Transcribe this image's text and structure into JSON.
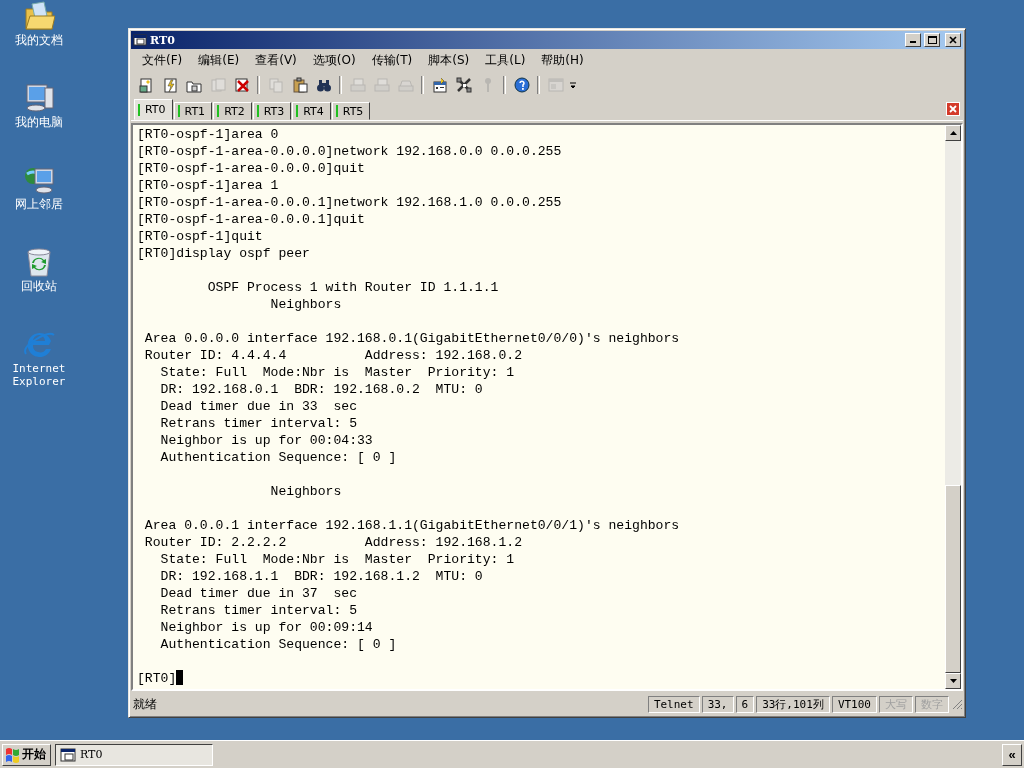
{
  "desktop_icons": [
    {
      "kind": "documents",
      "label": "我的文档"
    },
    {
      "kind": "computer",
      "label": "我的电脑"
    },
    {
      "kind": "network",
      "label": "网上邻居"
    },
    {
      "kind": "recycle",
      "label": "回收站"
    },
    {
      "kind": "browser",
      "label": "Internet Explorer"
    }
  ],
  "window": {
    "title": "RT0"
  },
  "menu": [
    "文件(F)",
    "编辑(E)",
    "查看(V)",
    "选项(O)",
    "传输(T)",
    "脚本(S)",
    "工具(L)",
    "帮助(H)"
  ],
  "toolbar": [
    {
      "kind": "new",
      "disabled": false
    },
    {
      "kind": "quick",
      "disabled": false
    },
    {
      "kind": "folder",
      "disabled": false
    },
    {
      "kind": "reconnect",
      "disabled": true
    },
    {
      "kind": "disconnect",
      "disabled": false
    },
    {
      "kind": "separator"
    },
    {
      "kind": "copy",
      "disabled": true
    },
    {
      "kind": "paste",
      "disabled": false
    },
    {
      "kind": "find",
      "disabled": false
    },
    {
      "kind": "separator"
    },
    {
      "kind": "print",
      "disabled": true
    },
    {
      "kind": "print",
      "disabled": true
    },
    {
      "kind": "printer",
      "disabled": true
    },
    {
      "kind": "separator"
    },
    {
      "kind": "options",
      "disabled": false
    },
    {
      "kind": "tools",
      "disabled": false
    },
    {
      "kind": "key",
      "disabled": true
    },
    {
      "kind": "separator"
    },
    {
      "kind": "help",
      "disabled": false
    },
    {
      "kind": "separator"
    },
    {
      "kind": "window",
      "disabled": true
    }
  ],
  "tabs": [
    {
      "label": "RT0",
      "selected": true,
      "connected": true
    },
    {
      "label": "RT1",
      "selected": false,
      "connected": true
    },
    {
      "label": "RT2",
      "selected": false,
      "connected": true
    },
    {
      "label": "RT3",
      "selected": false,
      "connected": true
    },
    {
      "label": "RT4",
      "selected": false,
      "connected": true
    },
    {
      "label": "RT5",
      "selected": false,
      "connected": true
    }
  ],
  "terminal": {
    "blocks": [
      [
        "[RT0-ospf-1]area 0",
        "[RT0-ospf-1-area-0.0.0.0]network 192.168.0.0 0.0.0.255",
        "[RT0-ospf-1-area-0.0.0.0]quit",
        "[RT0-ospf-1]area 1",
        "[RT0-ospf-1-area-0.0.0.1]network 192.168.1.0 0.0.0.255",
        "[RT0-ospf-1-area-0.0.0.1]quit",
        "[RT0-ospf-1]quit",
        "[RT0]display ospf peer"
      ],
      [
        "         OSPF Process 1 with Router ID 1.1.1.1",
        "                 Neighbors"
      ],
      [
        " Area 0.0.0.0 interface 192.168.0.1(GigabitEthernet0/0/0)'s neighbors",
        " Router ID: 4.4.4.4          Address: 192.168.0.2",
        "   State: Full  Mode:Nbr is  Master  Priority: 1",
        "   DR: 192.168.0.1  BDR: 192.168.0.2  MTU: 0",
        "   Dead timer due in 33  sec",
        "   Retrans timer interval: 5",
        "   Neighbor is up for 00:04:33",
        "   Authentication Sequence: [ 0 ]"
      ],
      [
        "                 Neighbors"
      ],
      [
        " Area 0.0.0.1 interface 192.168.1.1(GigabitEthernet0/0/1)'s neighbors",
        " Router ID: 2.2.2.2          Address: 192.168.1.2",
        "   State: Full  Mode:Nbr is  Master  Priority: 1",
        "   DR: 192.168.1.1  BDR: 192.168.1.2  MTU: 0",
        "   Dead timer due in 37  sec",
        "   Retrans timer interval: 5",
        "   Neighbor is up for 00:09:14",
        "   Authentication Sequence: [ 0 ]"
      ],
      [
        "[RT0]"
      ]
    ],
    "cursor": true
  },
  "status_bar": {
    "message": "就绪",
    "fields": [
      {
        "text": "Telnet",
        "disabled": false
      },
      {
        "text": "33,",
        "disabled": false
      },
      {
        "text": "6",
        "disabled": false
      },
      {
        "text": "33行,101列",
        "disabled": false
      },
      {
        "text": "VT100",
        "disabled": false
      },
      {
        "text": "大写",
        "disabled": true
      },
      {
        "text": "数字",
        "disabled": true
      }
    ]
  },
  "taskbar": {
    "start": "开始",
    "tasks": [
      {
        "label": "RT0",
        "selected": true
      }
    ],
    "tray_button": "«"
  }
}
